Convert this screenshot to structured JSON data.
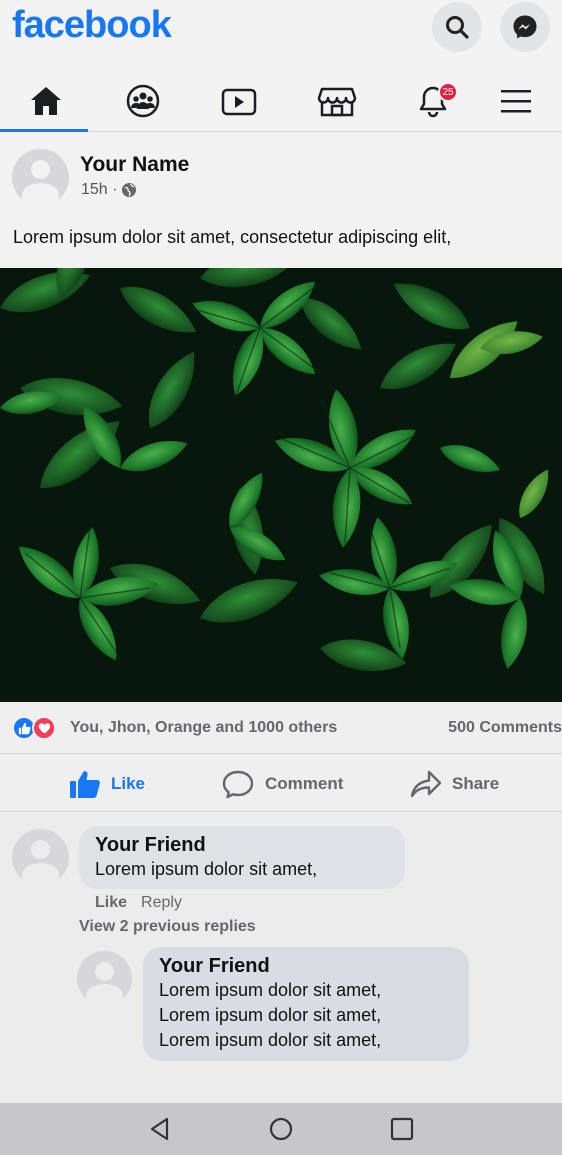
{
  "app": {
    "logo": "facebook"
  },
  "header": {
    "search_icon": "search-icon",
    "messenger_icon": "messenger-icon"
  },
  "nav": {
    "active": "home",
    "items": [
      "home-icon",
      "groups-icon",
      "watch-icon",
      "marketplace-icon",
      "notifications-icon",
      "menu-icon"
    ],
    "notification_badge": "25"
  },
  "post": {
    "author": "Your Name",
    "time": "15h ·",
    "text": "Lorem ipsum dolor sit amet, consectetur adipiscing elit,",
    "reactions_text": "You, Jhon, Orange and 1000 others",
    "comments_count": "500 Comments",
    "actions": {
      "like": "Like",
      "comment": "Comment",
      "share": "Share"
    }
  },
  "comments": [
    {
      "author": "Your Friend",
      "text": "Lorem ipsum dolor sit amet,",
      "like_label": "Like",
      "reply_label": "Reply",
      "view_replies": "View 2 previous replies"
    }
  ],
  "reply": {
    "author": "Your Friend",
    "lines": [
      "Lorem ipsum dolor sit amet,",
      "Lorem ipsum dolor sit amet,",
      "Lorem ipsum dolor sit amet,"
    ]
  },
  "colors": {
    "brand": "#1877f2",
    "badge": "#e41e3f",
    "love": "#f33e58"
  }
}
